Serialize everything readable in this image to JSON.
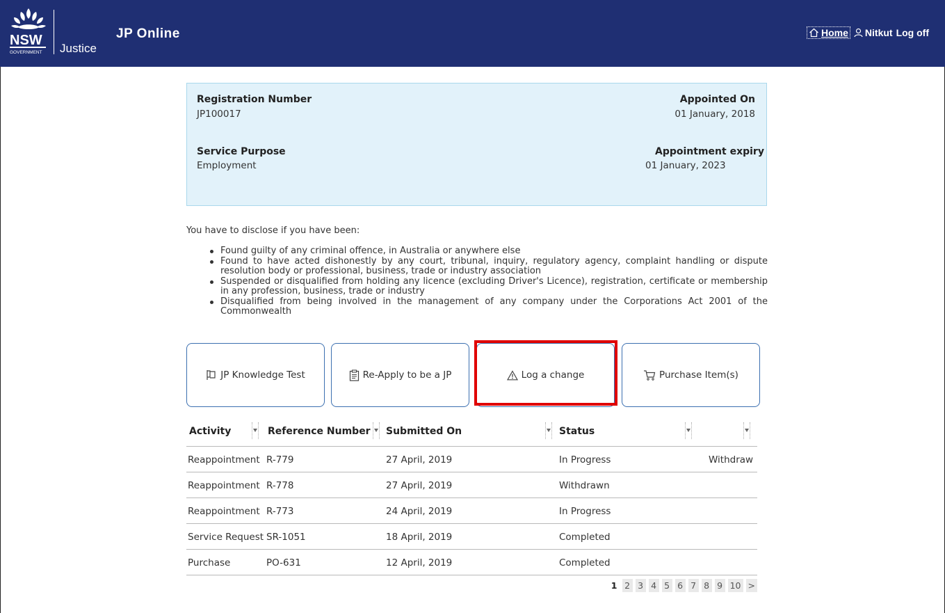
{
  "header": {
    "logo_text": "NSW",
    "logo_subtext": "GOVERNMENT",
    "justice": "Justice",
    "title": "JP Online",
    "nav": {
      "home": "Home",
      "user": "Nitkut",
      "logoff": "Log off"
    }
  },
  "info": {
    "registration_label": "Registration Number",
    "registration_value": "JP100017",
    "appointed_label": "Appointed On",
    "appointed_value": "01 January, 2018",
    "purpose_label": "Service Purpose",
    "purpose_value": "Employment",
    "expiry_label": "Appointment expiry",
    "expiry_value": "01 January, 2023"
  },
  "disclosure": {
    "intro": "You have to disclose if you have been:",
    "items": [
      "Found guilty of any criminal offence, in Australia or anywhere else",
      "Found to have acted dishonestly by any court, tribunal, inquiry, regulatory agency, complaint handling or dispute resolution body or professional, business, trade or industry association",
      "Suspended or disqualified from holding any licence (excluding Driver's Licence), registration, certificate or membership in any profession, business, trade or industry",
      "Disqualified from being involved in the management of any company under the Corporations Act 2001 of the Commonwealth"
    ]
  },
  "actions": {
    "knowledge_test": "JP Knowledge Test",
    "reapply": "Re-Apply to be a JP",
    "log_change": "Log a change",
    "purchase": "Purchase Item(s)"
  },
  "table": {
    "columns": [
      "Activity",
      "Reference Number",
      "Submitted On",
      "Status",
      ""
    ],
    "rows": [
      {
        "activity": "Reappointment",
        "ref": "R-779",
        "submitted": "27 April, 2019",
        "status": "In Progress",
        "action": "Withdraw"
      },
      {
        "activity": "Reappointment",
        "ref": "R-778",
        "submitted": "27 April, 2019",
        "status": "Withdrawn",
        "action": ""
      },
      {
        "activity": "Reappointment",
        "ref": "R-773",
        "submitted": "24 April, 2019",
        "status": "In Progress",
        "action": ""
      },
      {
        "activity": "Service Request",
        "ref": "SR-1051",
        "submitted": "18 April, 2019",
        "status": "Completed",
        "action": ""
      },
      {
        "activity": "Purchase",
        "ref": "PO-631",
        "submitted": "12 April, 2019",
        "status": "Completed",
        "action": ""
      }
    ]
  },
  "pagination": {
    "pages": [
      "1",
      "2",
      "3",
      "4",
      "5",
      "6",
      "7",
      "8",
      "9",
      "10"
    ],
    "next": ">",
    "current": "1"
  },
  "colors": {
    "header_bg": "#1f2f73",
    "info_bg": "#e2f2fa",
    "button_border": "#3b6fb0",
    "highlight": "#e00000"
  }
}
